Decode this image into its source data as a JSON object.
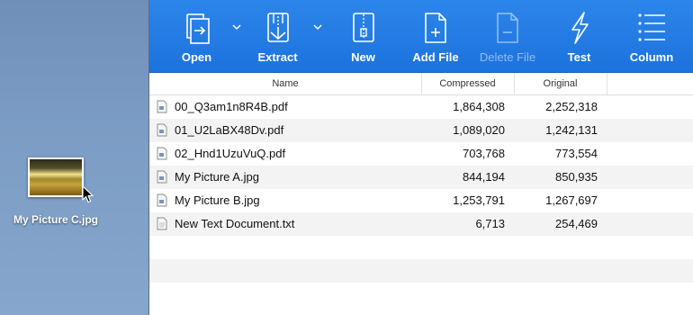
{
  "desktop": {
    "file_label": "My Picture C.jpg"
  },
  "toolbar": {
    "buttons": [
      {
        "label": "Open",
        "icon": "open-icon",
        "enabled": true
      },
      {
        "label": "Extract",
        "icon": "extract-icon",
        "enabled": true
      },
      {
        "label": "New",
        "icon": "new-archive-icon",
        "enabled": true
      },
      {
        "label": "Add File",
        "icon": "add-file-icon",
        "enabled": true
      },
      {
        "label": "Delete File",
        "icon": "delete-file-icon",
        "enabled": false
      },
      {
        "label": "Test",
        "icon": "test-icon",
        "enabled": true
      },
      {
        "label": "Column",
        "icon": "column-icon",
        "enabled": true
      }
    ]
  },
  "table": {
    "columns": [
      "Name",
      "Compressed",
      "Original"
    ],
    "rows": [
      {
        "name": "00_Q3am1n8R4B.pdf",
        "compressed": "1,864,308",
        "original": "2,252,318",
        "type": "pdf"
      },
      {
        "name": "01_U2LaBX48Dv.pdf",
        "compressed": "1,089,020",
        "original": "1,242,131",
        "type": "pdf"
      },
      {
        "name": "02_Hnd1UzuVuQ.pdf",
        "compressed": "703,768",
        "original": "773,554",
        "type": "pdf"
      },
      {
        "name": "My Picture A.jpg",
        "compressed": "844,194",
        "original": "850,935",
        "type": "jpg"
      },
      {
        "name": "My Picture B.jpg",
        "compressed": "1,253,791",
        "original": "1,267,697",
        "type": "jpg"
      },
      {
        "name": "New Text Document.txt",
        "compressed": "6,713",
        "original": "254,469",
        "type": "txt"
      }
    ]
  }
}
